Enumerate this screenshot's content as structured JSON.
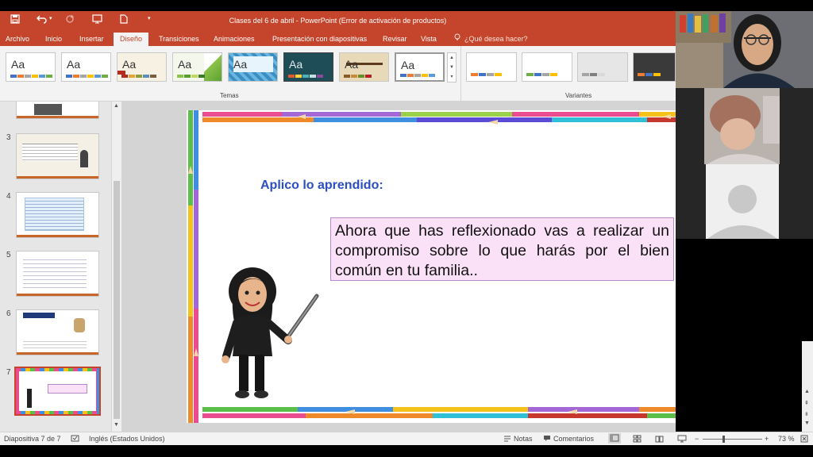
{
  "titlebar": {
    "title": "Clases del 6 de abril - PowerPoint (Error de activación de productos)"
  },
  "tabs": [
    {
      "label": "Archivo"
    },
    {
      "label": "Inicio"
    },
    {
      "label": "Insertar"
    },
    {
      "label": "Diseño"
    },
    {
      "label": "Transiciones"
    },
    {
      "label": "Animaciones"
    },
    {
      "label": "Presentación con diapositivas"
    },
    {
      "label": "Revisar"
    },
    {
      "label": "Vista"
    },
    {
      "label": "¿Qué desea hacer?"
    }
  ],
  "ribbon": {
    "theme_sample": "Aa",
    "themes_label": "Temas",
    "variants_label": "Variantes"
  },
  "thumbnails": {
    "numbers": [
      "3",
      "4",
      "5",
      "6",
      "7"
    ]
  },
  "slide": {
    "heading": "Aplico lo aprendido:",
    "body": "Ahora que has reflexionado vas a realizar un compromiso sobre lo que harás por el bien común en tu familia.."
  },
  "status": {
    "slide_counter": "Diapositiva 7 de 7",
    "language": "Inglés (Estados Unidos)",
    "notes": "Notas",
    "comments": "Comentarios",
    "zoom": "73 %"
  },
  "colors": {
    "accent": "#c5452c",
    "heading": "#2b4ec2",
    "textbox_fill": "#fbe1f7"
  }
}
